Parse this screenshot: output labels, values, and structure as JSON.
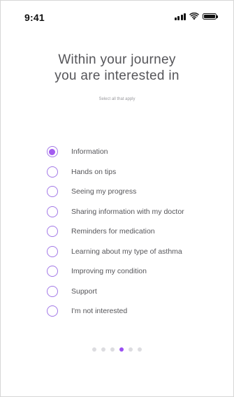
{
  "status_bar": {
    "time": "9:41",
    "icons": [
      "signal-icon",
      "wifi-icon",
      "battery-icon"
    ]
  },
  "header": {
    "title_line1": "Within your journey",
    "title_line2": "you are interested in",
    "subtitle": "Select all that apply"
  },
  "options": [
    {
      "label": "Information",
      "selected": true
    },
    {
      "label": "Hands on tips",
      "selected": false
    },
    {
      "label": "Seeing my progress",
      "selected": false
    },
    {
      "label": "Sharing information with my doctor",
      "selected": false
    },
    {
      "label": "Reminders for medication",
      "selected": false
    },
    {
      "label": "Learning about my type of asthma",
      "selected": false
    },
    {
      "label": "Improving my condition",
      "selected": false
    },
    {
      "label": "Support",
      "selected": false
    },
    {
      "label": "I'm not interested",
      "selected": false
    }
  ],
  "pager": {
    "total": 6,
    "active_index": 3
  },
  "colors": {
    "accent": "#a35cf0",
    "radio_border": "#a278e6",
    "pager_active": "#9a4ff2",
    "pager_inactive": "#dcdce0",
    "text": "#555559"
  }
}
